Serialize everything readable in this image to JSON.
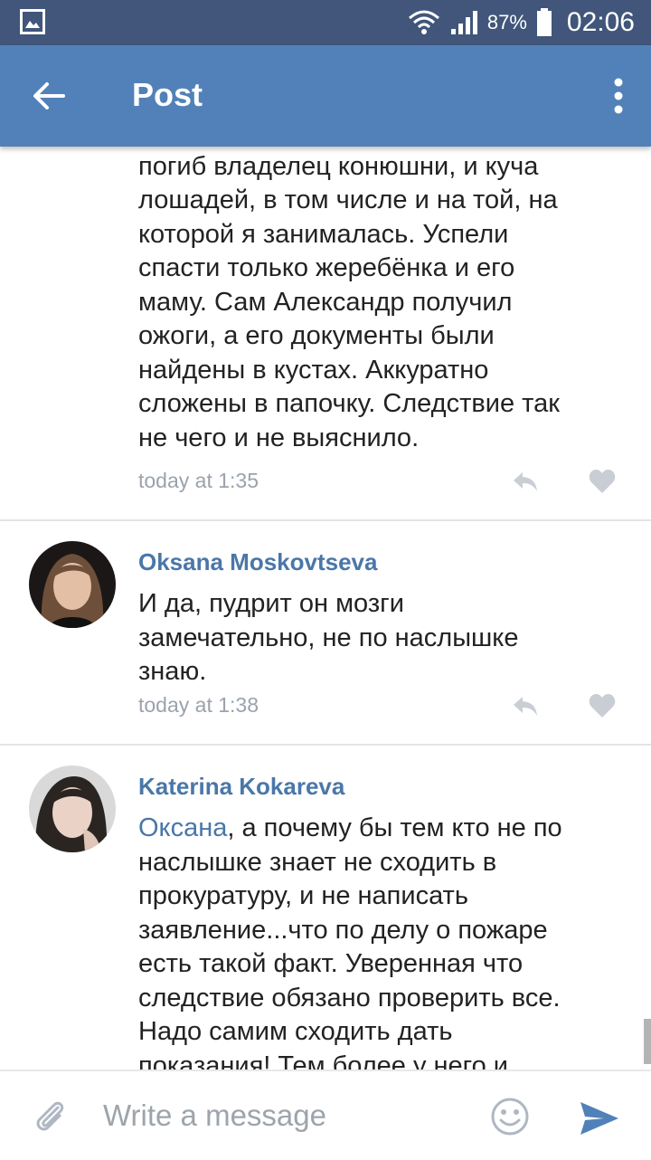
{
  "status_bar": {
    "battery": "87%",
    "time": "02:06"
  },
  "app_bar": {
    "title": "Post"
  },
  "comments": [
    {
      "text_lines": [
        "погиб владелец конюшни, и куча",
        "лошадей, в том числе и на той, на",
        "которой я занималась. Успели",
        "спасти только жеребёнка и его",
        "маму. Сам Александр получил",
        "ожоги, а его документы были",
        "найдены в кустах. Аккуратно",
        "сложены в папочку. Следствие так",
        "не чего и не выяснило."
      ],
      "time": "today at 1:35"
    },
    {
      "author": "Oksana Moskovtseva",
      "text_lines": [
        "И да, пудрит он мозги",
        "замечательно, не по наслышке",
        "знаю."
      ],
      "time": "today at 1:38"
    },
    {
      "author": "Katerina Kokareva",
      "mention": "Оксана",
      "first_line_rest": ", а почему бы тем кто не по",
      "text_lines": [
        "наслышке знает не сходить в",
        "прокуратуру, и не написать",
        "заявление...что по делу о пожаре",
        "есть такой факт. Уверенная что",
        "следствие обязано проверить все.",
        "Надо самим сходить дать",
        "показания! Тем более у него и"
      ]
    }
  ],
  "composer": {
    "placeholder": "Write a message"
  },
  "colors": {
    "status_bar": "#41567a",
    "app_bar": "#5181b8",
    "link": "#4a77a8",
    "meta": "#9aa3ad"
  },
  "icons": [
    "gallery-icon",
    "wifi-icon",
    "signal-icon",
    "battery-icon",
    "back-arrow-icon",
    "more-vert-icon",
    "reply-icon",
    "like-icon",
    "attach-icon",
    "emoji-icon",
    "send-icon"
  ]
}
